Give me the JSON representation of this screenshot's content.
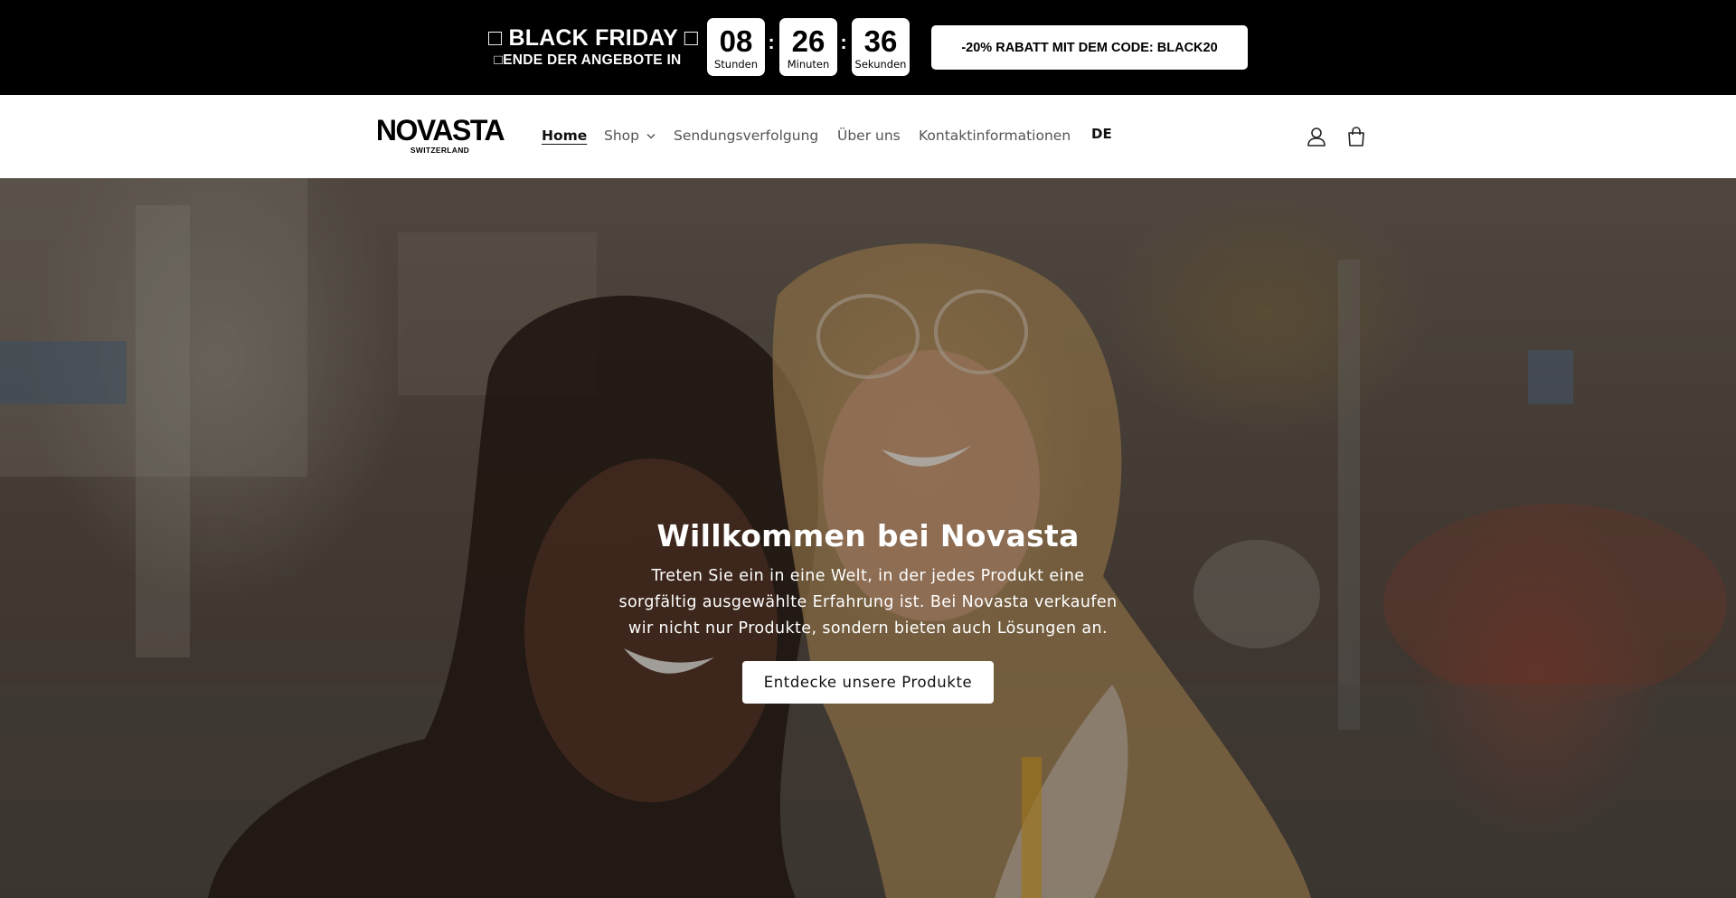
{
  "promo": {
    "title": "\u0000 BLACK FRIDAY \u0000",
    "title_display": "□ BLACK FRIDAY □",
    "subtitle": "□ENDE DER ANGEBOTE IN",
    "countdown": {
      "hours": "08",
      "hours_label": "Stunden",
      "minutes": "26",
      "minutes_label": "Minuten",
      "seconds": "36",
      "seconds_label": "Sekunden",
      "separator": ":"
    },
    "code_button": "-20% RABATT MIT DEM CODE: BLACK20"
  },
  "header": {
    "logo_main": "NOVASTA",
    "logo_sub": "SWITZERLAND",
    "nav": {
      "home": "Home",
      "shop": "Shop",
      "tracking": "Sendungsverfolgung",
      "about": "Über uns",
      "contact": "Kontaktinformationen"
    },
    "language": "DE",
    "icons": [
      "account-icon",
      "cart-icon"
    ]
  },
  "hero": {
    "title": "Willkommen bei Novasta",
    "text": "Treten Sie ein in eine Welt, in der jedes Produkt eine sorgfältig ausgewählte Erfahrung ist. Bei Novasta verkaufen wir nicht nur Produkte, sondern bieten auch Lösungen an.",
    "button": "Entdecke unsere Produkte"
  },
  "colors": {
    "promo_bg": "#000000",
    "header_bg": "#ffffff",
    "nav_text": "#555555",
    "hero_text": "#ffffff"
  }
}
